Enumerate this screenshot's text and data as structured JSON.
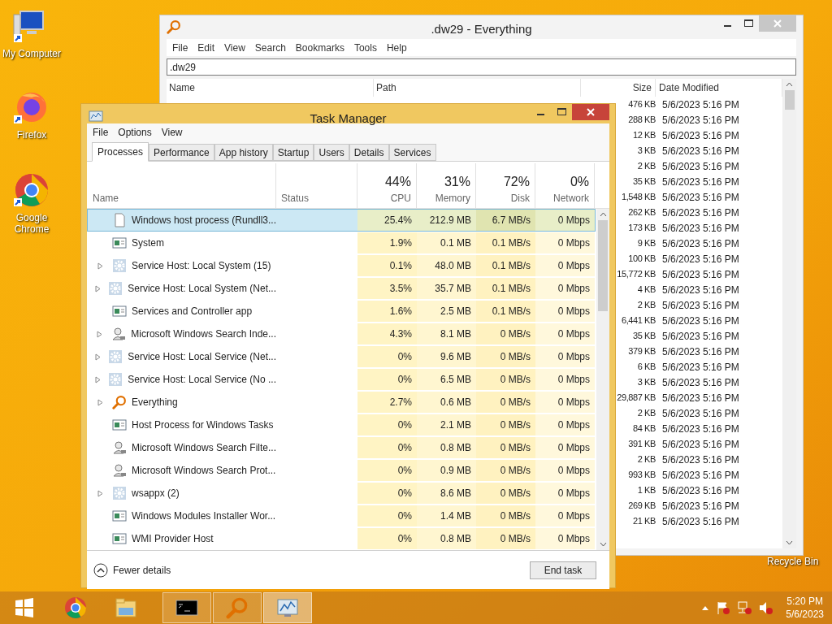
{
  "desktop_icons": [
    {
      "label": "My Computer",
      "kind": "computer"
    },
    {
      "label": "Firefox",
      "kind": "firefox"
    },
    {
      "label": "Google Chrome",
      "kind": "chrome"
    },
    {
      "label": "Recycle Bin",
      "kind": "hidden"
    }
  ],
  "everything_window": {
    "title": ".dw29 - Everything",
    "menu": [
      "File",
      "Edit",
      "View",
      "Search",
      "Bookmarks",
      "Tools",
      "Help"
    ],
    "search": {
      "value": ".dw29"
    },
    "columns": [
      "Name",
      "Path",
      "Size",
      "Date Modified"
    ],
    "rows": [
      {
        "size": "476 KB",
        "date_modified": "5/6/2023 5:16 PM"
      },
      {
        "size": "288 KB",
        "date_modified": "5/6/2023 5:16 PM"
      },
      {
        "size": "12 KB",
        "date_modified": "5/6/2023 5:16 PM"
      },
      {
        "size": "3 KB",
        "date_modified": "5/6/2023 5:16 PM"
      },
      {
        "size": "2 KB",
        "date_modified": "5/6/2023 5:16 PM"
      },
      {
        "size": "35 KB",
        "date_modified": "5/6/2023 5:16 PM"
      },
      {
        "size": "1,548 KB",
        "date_modified": "5/6/2023 5:16 PM"
      },
      {
        "size": "262 KB",
        "date_modified": "5/6/2023 5:16 PM"
      },
      {
        "size": "173 KB",
        "date_modified": "5/6/2023 5:16 PM"
      },
      {
        "size": "9 KB",
        "date_modified": "5/6/2023 5:16 PM"
      },
      {
        "size": "100 KB",
        "date_modified": "5/6/2023 5:16 PM"
      },
      {
        "size": "15,772 KB",
        "date_modified": "5/6/2023 5:16 PM"
      },
      {
        "size": "4 KB",
        "date_modified": "5/6/2023 5:16 PM"
      },
      {
        "size": "2 KB",
        "date_modified": "5/6/2023 5:16 PM"
      },
      {
        "size": "6,441 KB",
        "date_modified": "5/6/2023 5:16 PM"
      },
      {
        "size": "35 KB",
        "date_modified": "5/6/2023 5:16 PM"
      },
      {
        "size": "379 KB",
        "date_modified": "5/6/2023 5:16 PM"
      },
      {
        "size": "6 KB",
        "date_modified": "5/6/2023 5:16 PM"
      },
      {
        "size": "3 KB",
        "date_modified": "5/6/2023 5:16 PM"
      },
      {
        "size": "29,887 KB",
        "date_modified": "5/6/2023 5:16 PM"
      },
      {
        "size": "2 KB",
        "date_modified": "5/6/2023 5:16 PM"
      },
      {
        "size": "84 KB",
        "date_modified": "5/6/2023 5:16 PM"
      },
      {
        "size": "391 KB",
        "date_modified": "5/6/2023 5:16 PM"
      },
      {
        "size": "2 KB",
        "date_modified": "5/6/2023 5:16 PM"
      },
      {
        "size": "993 KB",
        "date_modified": "5/6/2023 5:16 PM"
      },
      {
        "size": "1 KB",
        "date_modified": "5/6/2023 5:16 PM"
      },
      {
        "size": "269 KB",
        "date_modified": "5/6/2023 5:16 PM"
      },
      {
        "size": "21 KB",
        "date_modified": "5/6/2023 5:16 PM"
      }
    ]
  },
  "task_manager": {
    "title": "Task Manager",
    "menu": [
      "File",
      "Options",
      "View"
    ],
    "tabs": [
      {
        "label": "Processes",
        "selected": true
      },
      {
        "label": "Performance",
        "selected": false
      },
      {
        "label": "App history",
        "selected": false
      },
      {
        "label": "Startup",
        "selected": false
      },
      {
        "label": "Users",
        "selected": false
      },
      {
        "label": "Details",
        "selected": false
      },
      {
        "label": "Services",
        "selected": false
      }
    ],
    "columns": [
      {
        "label": "Name"
      },
      {
        "label": "Status"
      },
      {
        "percent": "44%",
        "label": "CPU"
      },
      {
        "percent": "31%",
        "label": "Memory"
      },
      {
        "percent": "72%",
        "label": "Disk"
      },
      {
        "percent": "0%",
        "label": "Network"
      }
    ],
    "processes": [
      {
        "name": "Windows host process (Rundll3...",
        "kind": "file",
        "expandable": false,
        "selected": true,
        "cpu": "25.4%",
        "memory": "212.9 MB",
        "disk": "6.7 MB/s",
        "network": "0 Mbps"
      },
      {
        "name": "System",
        "kind": "window",
        "expandable": false,
        "selected": false,
        "cpu": "1.9%",
        "memory": "0.1 MB",
        "disk": "0.1 MB/s",
        "network": "0 Mbps"
      },
      {
        "name": "Service Host: Local System (15)",
        "kind": "gear",
        "expandable": true,
        "selected": false,
        "cpu": "0.1%",
        "memory": "48.0 MB",
        "disk": "0.1 MB/s",
        "network": "0 Mbps"
      },
      {
        "name": "Service Host: Local System (Net...",
        "kind": "gear",
        "expandable": true,
        "selected": false,
        "cpu": "3.5%",
        "memory": "35.7 MB",
        "disk": "0.1 MB/s",
        "network": "0 Mbps"
      },
      {
        "name": "Services and Controller app",
        "kind": "window",
        "expandable": false,
        "selected": false,
        "cpu": "1.6%",
        "memory": "2.5 MB",
        "disk": "0.1 MB/s",
        "network": "0 Mbps"
      },
      {
        "name": "Microsoft Windows Search Inde...",
        "kind": "user",
        "expandable": true,
        "selected": false,
        "cpu": "4.3%",
        "memory": "8.1 MB",
        "disk": "0 MB/s",
        "network": "0 Mbps"
      },
      {
        "name": "Service Host: Local Service (Net...",
        "kind": "gear",
        "expandable": true,
        "selected": false,
        "cpu": "0%",
        "memory": "9.6 MB",
        "disk": "0 MB/s",
        "network": "0 Mbps"
      },
      {
        "name": "Service Host: Local Service (No ...",
        "kind": "gear",
        "expandable": true,
        "selected": false,
        "cpu": "0%",
        "memory": "6.5 MB",
        "disk": "0 MB/s",
        "network": "0 Mbps"
      },
      {
        "name": "Everything",
        "kind": "magnifier",
        "expandable": true,
        "selected": false,
        "cpu": "2.7%",
        "memory": "0.6 MB",
        "disk": "0 MB/s",
        "network": "0 Mbps"
      },
      {
        "name": "Host Process for Windows Tasks",
        "kind": "window",
        "expandable": false,
        "selected": false,
        "cpu": "0%",
        "memory": "2.1 MB",
        "disk": "0 MB/s",
        "network": "0 Mbps"
      },
      {
        "name": "Microsoft Windows Search Filte...",
        "kind": "user",
        "expandable": false,
        "selected": false,
        "cpu": "0%",
        "memory": "0.8 MB",
        "disk": "0 MB/s",
        "network": "0 Mbps"
      },
      {
        "name": "Microsoft Windows Search Prot...",
        "kind": "user",
        "expandable": false,
        "selected": false,
        "cpu": "0%",
        "memory": "0.9 MB",
        "disk": "0 MB/s",
        "network": "0 Mbps"
      },
      {
        "name": "wsappx (2)",
        "kind": "gear",
        "expandable": true,
        "selected": false,
        "cpu": "0%",
        "memory": "8.6 MB",
        "disk": "0 MB/s",
        "network": "0 Mbps"
      },
      {
        "name": "Windows Modules Installer Wor...",
        "kind": "window",
        "expandable": false,
        "selected": false,
        "cpu": "0%",
        "memory": "1.4 MB",
        "disk": "0 MB/s",
        "network": "0 Mbps"
      },
      {
        "name": "WMI Provider Host",
        "kind": "window",
        "expandable": false,
        "selected": false,
        "cpu": "0%",
        "memory": "0.8 MB",
        "disk": "0 MB/s",
        "network": "0 Mbps"
      }
    ],
    "fewer_details": "Fewer details",
    "end_task": "End task"
  },
  "taskbar": {
    "items": [
      {
        "kind": "start",
        "running": false,
        "active": false
      },
      {
        "kind": "chrome",
        "running": false,
        "active": false
      },
      {
        "kind": "explorer",
        "running": false,
        "active": false
      },
      {
        "kind": "console",
        "running": true,
        "active": false
      },
      {
        "kind": "magnifier",
        "running": true,
        "active": false
      },
      {
        "kind": "monitor",
        "running": true,
        "active": true
      }
    ],
    "clock": {
      "time": "5:20 PM",
      "date": "5/6/2023"
    }
  }
}
